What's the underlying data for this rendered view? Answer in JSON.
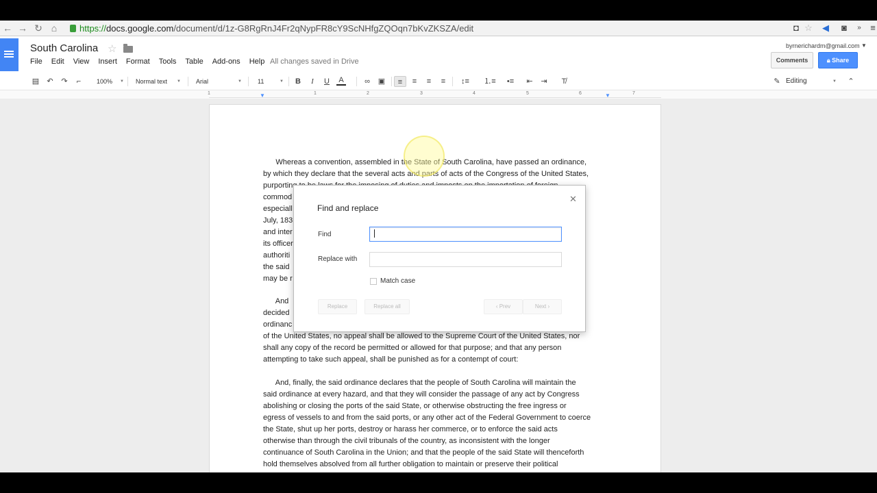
{
  "browser": {
    "url_scheme": "https://",
    "url_host": "docs.google.com",
    "url_path": "/document/d/1z-G8RgRnJ4Fr2qNypFR8cY9ScNHfgZQOqn7bKvZKSZA/edit"
  },
  "doc": {
    "title": "South Carolina",
    "save_status": "All changes saved in Drive",
    "account": "byrnerichardm@gmail.com",
    "comments_label": "Comments",
    "share_label": "Share"
  },
  "menu": [
    "File",
    "Edit",
    "View",
    "Insert",
    "Format",
    "Tools",
    "Table",
    "Add-ons",
    "Help"
  ],
  "toolbar": {
    "zoom": "100%",
    "style": "Normal text",
    "font": "Arial",
    "size": "11",
    "mode": "Editing"
  },
  "ruler": {
    "ticks": [
      "1",
      "1",
      "2",
      "3",
      "4",
      "5",
      "6",
      "7"
    ]
  },
  "paragraphs": [
    [
      "      Whereas a convention, assembled in the State of South Carolina, have passed an ordinance,",
      "by which they declare that the several acts and parts of acts of the Congress of the United States,",
      "purporting to be laws for the imposing of duties and imposts on the importation of foreign",
      "commod                                                                                                    e",
      "especiall                                                                                              th of",
      "July, 183                                                                                              eaning",
      "and inter                                                                                              e or",
      "its officer                                                                                            stituted",
      "authoriti                                                                                              d by",
      "the said                                                                                               s as",
      "may be r"
    ],
    [
      "      And                                                                                                   y,",
      "decided                                                                                                d",
      "ordinanc                                                                                               laws",
      "of the United States, no appeal shall be allowed to the Supreme Court of the United States, nor",
      "shall any copy of the record be permitted or allowed for that purpose; and that any person",
      "attempting to take such appeal, shall be punished as for a contempt of court:"
    ],
    [
      "      And, finally, the said ordinance declares that the people of South Carolina will maintain the",
      "said ordinance at every hazard, and that they will consider the passage of any act by Congress",
      "abolishing or closing the ports of the said State, or otherwise obstructing the free ingress or",
      "egress of vessels to and from the said ports, or any other act of the Federal Government to coerce",
      "the State, shut up her ports, destroy or harass her commerce, or to enforce the said acts",
      "otherwise than through the civil tribunals of the country, as inconsistent with the longer",
      "continuance of South Carolina in the Union; and that the people of the said State will thenceforth",
      "hold themselves absolved from all further obligation to maintain or preserve their political"
    ]
  ],
  "dialog": {
    "title": "Find and replace",
    "find_label": "Find",
    "find_value": "",
    "replace_label": "Replace with",
    "replace_value": "",
    "match_case_label": "Match case",
    "replace_btn": "Replace",
    "replace_all_btn": "Replace all",
    "prev_btn": "‹  Prev",
    "next_btn": "Next  ›"
  },
  "colors": {
    "docs_blue": "#4285f4",
    "share_blue": "#4d90fe",
    "focus_blue": "#4d90fe"
  }
}
